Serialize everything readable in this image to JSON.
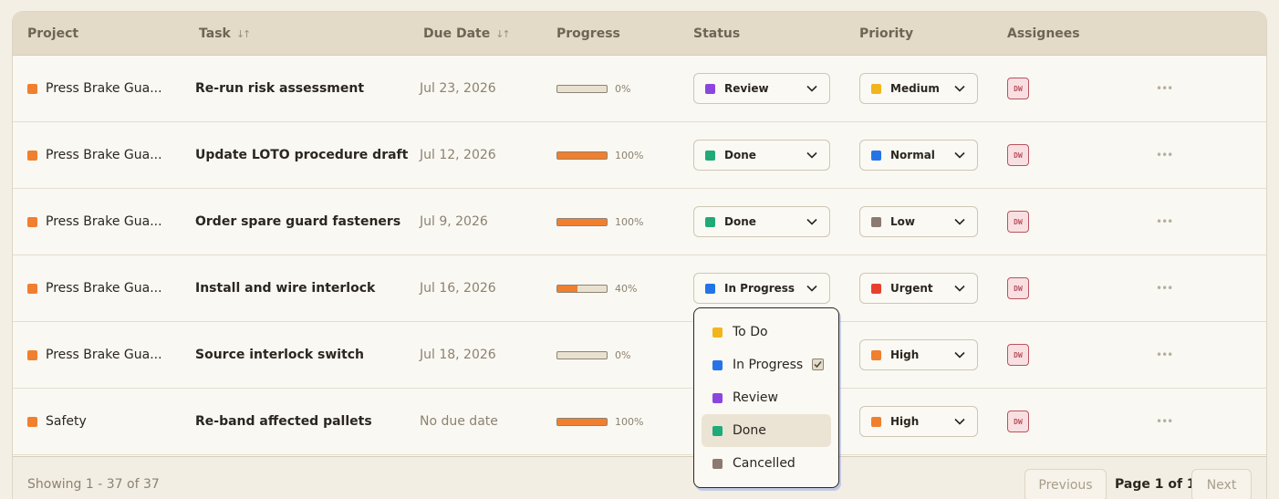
{
  "headers": {
    "project": "Project",
    "task": "Task",
    "due": "Due Date",
    "progress": "Progress",
    "status": "Status",
    "priority": "Priority",
    "assignees": "Assignees"
  },
  "rows": [
    {
      "project": "Press Brake Gua...",
      "task": "Re-run risk assessment",
      "due": "Jul 23, 2026",
      "progress": 0,
      "progress_label": "0%",
      "status": "Review",
      "status_color": "#8c46e0",
      "priority": "Medium",
      "priority_color": "#f2b51c",
      "assignee": "DW"
    },
    {
      "project": "Press Brake Gua...",
      "task": "Update LOTO procedure draft",
      "due": "Jul 12, 2026",
      "progress": 100,
      "progress_label": "100%",
      "status": "Done",
      "status_color": "#1faa78",
      "priority": "Normal",
      "priority_color": "#2474e8",
      "assignee": "DW"
    },
    {
      "project": "Press Brake Gua...",
      "task": "Order spare guard fasteners",
      "due": "Jul 9, 2026",
      "progress": 100,
      "progress_label": "100%",
      "status": "Done",
      "status_color": "#1faa78",
      "priority": "Low",
      "priority_color": "#8c7a70",
      "assignee": "DW"
    },
    {
      "project": "Press Brake Gua...",
      "task": "Install and wire interlock",
      "due": "Jul 16, 2026",
      "progress": 40,
      "progress_label": "40%",
      "status": "In Progress",
      "status_color": "#2474e8",
      "priority": "Urgent",
      "priority_color": "#e8402e",
      "assignee": "DW"
    },
    {
      "project": "Press Brake Gua...",
      "task": "Source interlock switch",
      "due": "Jul 18, 2026",
      "progress": 0,
      "progress_label": "0%",
      "status": "",
      "status_color": "",
      "priority": "High",
      "priority_color": "#f07f2e",
      "assignee": "DW"
    },
    {
      "project": "Safety",
      "task": "Re-band affected pallets",
      "due": "No due date",
      "progress": 100,
      "progress_label": "100%",
      "status": "",
      "status_color": "",
      "priority": "High",
      "priority_color": "#f07f2e",
      "assignee": "DW"
    }
  ],
  "status_dropdown": {
    "options": [
      {
        "label": "To Do",
        "color": "#f2b51c"
      },
      {
        "label": "In Progress",
        "color": "#2474e8",
        "checked": true
      },
      {
        "label": "Review",
        "color": "#8c46e0"
      },
      {
        "label": "Done",
        "color": "#1faa78",
        "highlighted": true
      },
      {
        "label": "Cancelled",
        "color": "#8c7a70"
      }
    ]
  },
  "footer": {
    "showing": "Showing 1 - 37 of 37",
    "previous": "Previous",
    "page_info": "Page 1 of 1",
    "next": "Next"
  },
  "colors": {
    "project_dot": "#f07f2e",
    "progress_fill": "#f07f2e"
  }
}
